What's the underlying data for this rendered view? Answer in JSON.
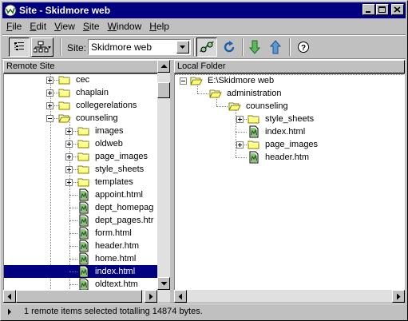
{
  "window": {
    "title": "Site - Skidmore web",
    "titlebar_color": "#000080",
    "selection_color": "#000080"
  },
  "menu": [
    {
      "label": "File",
      "accel": "F",
      "rest": "ile"
    },
    {
      "label": "Edit",
      "accel": "E",
      "rest": "dit"
    },
    {
      "label": "View",
      "accel": "V",
      "rest": "iew"
    },
    {
      "label": "Site",
      "accel": "S",
      "rest": "ite"
    },
    {
      "label": "Window",
      "accel": "W",
      "rest": "indow"
    },
    {
      "label": "Help",
      "accel": "H",
      "rest": "elp"
    }
  ],
  "toolbar": {
    "site_label": "Site:",
    "site_value": "Skidmore web",
    "buttons": [
      "site-files-view-icon",
      "site-map-view-icon",
      "connect-icon",
      "refresh-icon",
      "get-files-icon",
      "put-files-icon",
      "help-icon"
    ]
  },
  "remote": {
    "header": "Remote Site",
    "items": [
      {
        "label": "cec",
        "type": "folder",
        "expander": "plus"
      },
      {
        "label": "chaplain",
        "type": "folder",
        "expander": "plus"
      },
      {
        "label": "collegerelations",
        "type": "folder",
        "expander": "plus"
      },
      {
        "label": "counseling",
        "type": "folder-open",
        "expander": "minus"
      },
      {
        "label": "images",
        "type": "folder",
        "expander": "plus"
      },
      {
        "label": "oldweb",
        "type": "folder",
        "expander": "plus"
      },
      {
        "label": "page_images",
        "type": "folder",
        "expander": "plus"
      },
      {
        "label": "style_sheets",
        "type": "folder",
        "expander": "plus"
      },
      {
        "label": "templates",
        "type": "folder",
        "expander": "plus"
      },
      {
        "label": "appoint.html",
        "type": "file"
      },
      {
        "label": "dept_homepag",
        "type": "file"
      },
      {
        "label": "dept_pages.htr",
        "type": "file"
      },
      {
        "label": "form.html",
        "type": "file"
      },
      {
        "label": "header.htm",
        "type": "file"
      },
      {
        "label": "home.html",
        "type": "file"
      },
      {
        "label": "index.html",
        "type": "file",
        "selected": true
      },
      {
        "label": "oldtext.htm",
        "type": "file"
      }
    ]
  },
  "local": {
    "header": "Local Folder",
    "items": [
      {
        "label": "E:\\Skidmore web",
        "type": "folder-open",
        "expander": "minus"
      },
      {
        "label": "administration",
        "type": "folder-open"
      },
      {
        "label": "counseling",
        "type": "folder-open"
      },
      {
        "label": "style_sheets",
        "type": "folder",
        "expander": "plus"
      },
      {
        "label": "index.html",
        "type": "file"
      },
      {
        "label": "page_images",
        "type": "folder",
        "expander": "plus"
      },
      {
        "label": "header.htm",
        "type": "file"
      }
    ]
  },
  "status": {
    "text": "1 remote items selected totalling 14874 bytes."
  }
}
